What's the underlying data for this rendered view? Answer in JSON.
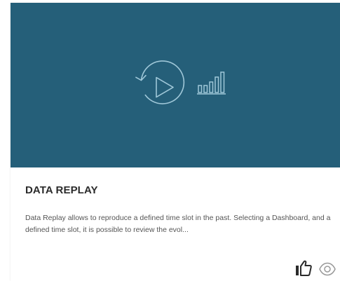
{
  "card": {
    "title": "DATA REPLAY",
    "description": "Data Replay allows to reproduce a defined time slot in the past. Selecting a Dashboard, and a defined time slot, it is possible to review the evol...",
    "hero": {
      "background_color": "#255f79",
      "icon_color": "#9fc7d8",
      "icons": [
        "replay-play-icon",
        "bar-chart-icon"
      ]
    },
    "actions": [
      {
        "name": "like",
        "icon": "thumbs-up-icon"
      },
      {
        "name": "view",
        "icon": "eye-icon"
      }
    ]
  }
}
